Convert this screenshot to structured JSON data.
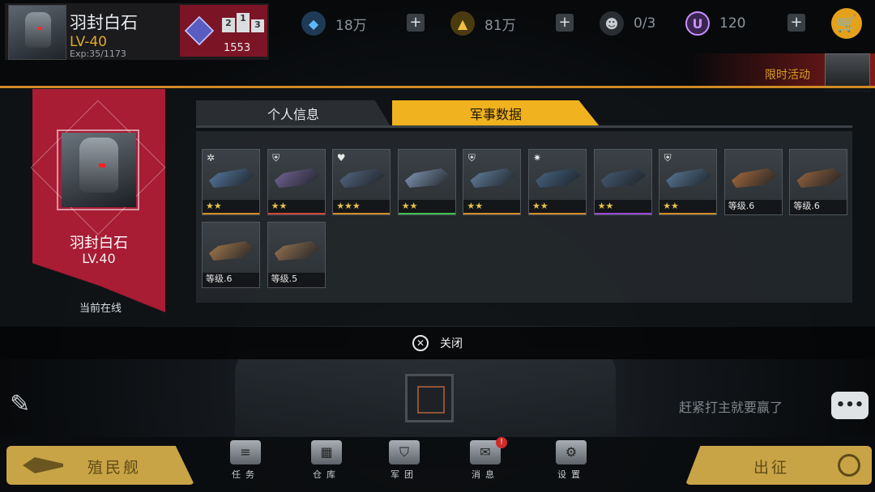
{
  "player": {
    "name": "羽封白石",
    "level": "LV-40",
    "exp": "Exp:35/1173"
  },
  "rank": {
    "podium": [
      "2",
      "1",
      "3"
    ],
    "score": "1553"
  },
  "resources": [
    {
      "icon": "crystal-icon",
      "value": "18万"
    },
    {
      "icon": "gold-icon",
      "value": "81万"
    },
    {
      "icon": "pilot-icon",
      "value": "0/3"
    },
    {
      "icon": "u-currency-icon",
      "glyph": "U",
      "value": "120"
    }
  ],
  "plus_label": "+",
  "event": {
    "label": "限时活动"
  },
  "card": {
    "name": "羽封白石",
    "level": "LV.40",
    "status": "当前在线"
  },
  "tabs": [
    {
      "label": "个人信息"
    },
    {
      "label": "军事数据"
    }
  ],
  "items": [
    {
      "badge": "✲",
      "foot": "★★",
      "color": "orange",
      "art": "#5b7fa8"
    },
    {
      "badge": "⛨",
      "foot": "★★",
      "color": "red",
      "art": "#7a6aa0"
    },
    {
      "badge": "♥",
      "foot": "★★★",
      "color": "orange",
      "art": "#5a6d8a"
    },
    {
      "badge": "",
      "foot": "★★",
      "color": "green",
      "art": "#8aa0c0"
    },
    {
      "badge": "⛨",
      "foot": "★★",
      "color": "orange",
      "art": "#6a88a8"
    },
    {
      "badge": "✷",
      "foot": "★★",
      "color": "orange",
      "art": "#4a6a8a"
    },
    {
      "badge": "",
      "foot": "★★",
      "color": "purple",
      "art": "#4a5f78"
    },
    {
      "badge": "⛨",
      "foot": "★★",
      "color": "orange",
      "art": "#5f7fa0"
    },
    {
      "badge": "",
      "foot": "等级.6",
      "color": "none",
      "art": "#b07040"
    },
    {
      "badge": "",
      "foot": "等级.6",
      "color": "none",
      "art": "#a06a40"
    },
    {
      "badge": "",
      "foot": "等级.6",
      "color": "none",
      "art": "#b08050"
    },
    {
      "badge": "",
      "foot": "等级.5",
      "color": "none",
      "art": "#a07a55"
    }
  ],
  "close": {
    "icon": "✕",
    "label": "关闭"
  },
  "chat": {
    "message": "赶紧打主就要赢了",
    "button": "•••"
  },
  "bottom": {
    "colony": "殖民舰",
    "sortie": "出征",
    "nav": [
      {
        "label": "任务",
        "icon": "task-icon"
      },
      {
        "label": "仓库",
        "icon": "warehouse-icon"
      },
      {
        "label": "军团",
        "icon": "legion-icon"
      },
      {
        "label": "消息",
        "icon": "message-icon"
      },
      {
        "label": "设置",
        "icon": "settings-icon"
      }
    ],
    "message_badge": "!"
  }
}
